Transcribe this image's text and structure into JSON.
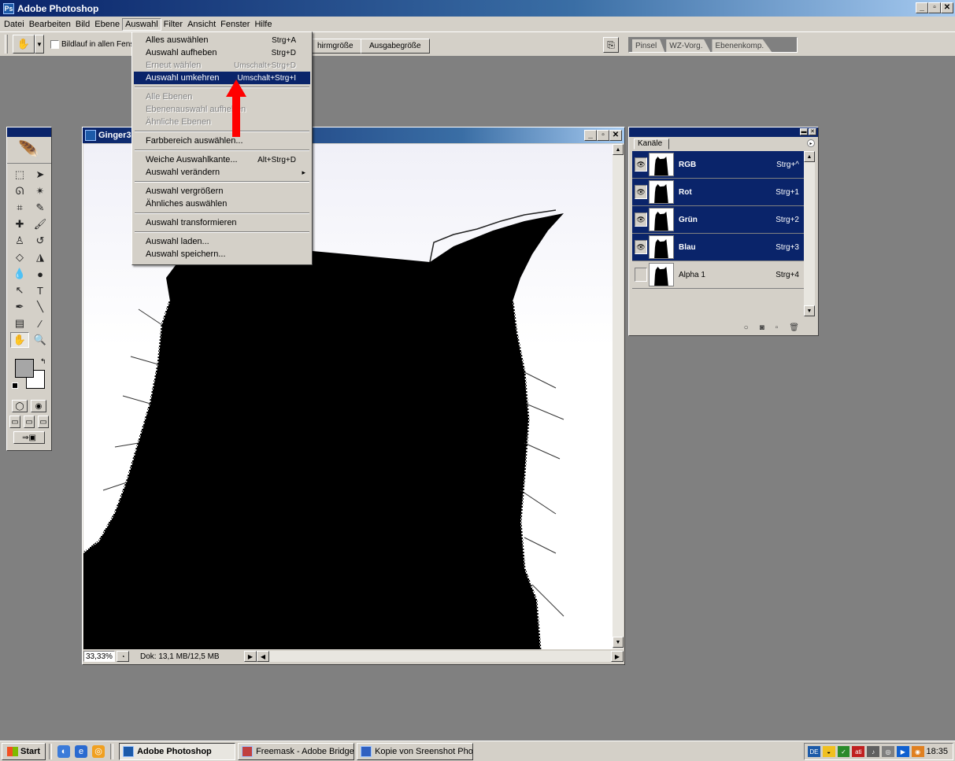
{
  "window": {
    "title": "Adobe Photoshop"
  },
  "menubar": {
    "items": [
      "Datei",
      "Bearbeiten",
      "Bild",
      "Ebene",
      "Auswahl",
      "Filter",
      "Ansicht",
      "Fenster",
      "Hilfe"
    ],
    "active": "Auswahl"
  },
  "options": {
    "checkbox_label": "Bildlauf in allen Fens",
    "screen_button": "hirmgröße",
    "print_button": "Ausgabegröße",
    "palette_tabs": [
      "Pinsel",
      "WZ-Vorg.",
      "Ebenenkomp."
    ]
  },
  "auswahl_menu": {
    "items": [
      {
        "label": "Alles auswählen",
        "shortcut": "Strg+A",
        "state": "normal"
      },
      {
        "label": "Auswahl aufheben",
        "shortcut": "Strg+D",
        "state": "normal"
      },
      {
        "label": "Erneut wählen",
        "shortcut": "Umschalt+Strg+D",
        "state": "disabled"
      },
      {
        "label": "Auswahl umkehren",
        "shortcut": "Umschalt+Strg+I",
        "state": "highlight"
      },
      {
        "label": "Alle Ebenen",
        "shortcut": "",
        "state": "disabled"
      },
      {
        "label": "Ebenenauswahl aufheben",
        "shortcut": "",
        "state": "disabled"
      },
      {
        "label": "Ähnliche Ebenen",
        "shortcut": "",
        "state": "disabled"
      },
      {
        "label": "Farbbereich auswählen...",
        "shortcut": "",
        "state": "normal"
      },
      {
        "label": "Weiche Auswahlkante...",
        "shortcut": "Alt+Strg+D",
        "state": "normal"
      },
      {
        "label": "Auswahl verändern",
        "shortcut": "",
        "state": "submenu"
      },
      {
        "label": "Auswahl vergrößern",
        "shortcut": "",
        "state": "normal"
      },
      {
        "label": "Ähnliches auswählen",
        "shortcut": "",
        "state": "normal"
      },
      {
        "label": "Auswahl transformieren",
        "shortcut": "",
        "state": "normal"
      },
      {
        "label": "Auswahl laden...",
        "shortcut": "",
        "state": "normal"
      },
      {
        "label": "Auswahl speichern...",
        "shortcut": "",
        "state": "normal"
      }
    ]
  },
  "document": {
    "title": "Ginger3",
    "zoom": "33,33%",
    "doc_info": "Dok: 13,1 MB/12,5 MB"
  },
  "channels": {
    "tab": "Kanäle",
    "rows": [
      {
        "name": "RGB",
        "shortcut": "Strg+^",
        "selected": true,
        "visible": true
      },
      {
        "name": "Rot",
        "shortcut": "Strg+1",
        "selected": true,
        "visible": true
      },
      {
        "name": "Grün",
        "shortcut": "Strg+2",
        "selected": true,
        "visible": true
      },
      {
        "name": "Blau",
        "shortcut": "Strg+3",
        "selected": true,
        "visible": true
      },
      {
        "name": "Alpha 1",
        "shortcut": "Strg+4",
        "selected": false,
        "visible": false
      }
    ]
  },
  "taskbar": {
    "start": "Start",
    "tasks": [
      "Adobe Photoshop",
      "Freemask - Adobe Bridge",
      "Kopie von Sreenshot Pho..."
    ],
    "active_task": "Adobe Photoshop",
    "lang": "DE",
    "clock": "18:35"
  },
  "colors": {
    "title_blue": "#0a246a",
    "menu_highlight": "#0a246a",
    "annotation_arrow": "#ff0000",
    "foreground": "#a6a6a6",
    "background": "#ffffff"
  }
}
